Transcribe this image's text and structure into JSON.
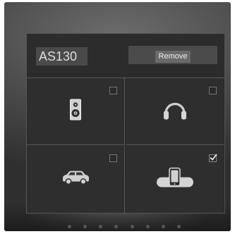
{
  "device": {
    "name": "AS130"
  },
  "actions": {
    "remove_label": "Remove"
  },
  "modes": [
    {
      "id": "speaker",
      "icon": "speaker-icon",
      "checked": false
    },
    {
      "id": "headphones",
      "icon": "headphones-icon",
      "checked": false
    },
    {
      "id": "car",
      "icon": "car-icon",
      "checked": false
    },
    {
      "id": "phone-dock",
      "icon": "phone-dock-icon",
      "checked": true
    }
  ],
  "colors": {
    "panel_bg": "#262626",
    "tile_bg": "#2e2e2e",
    "icon_fill": "#cfcfcf",
    "divider": "#5a5a5a"
  }
}
